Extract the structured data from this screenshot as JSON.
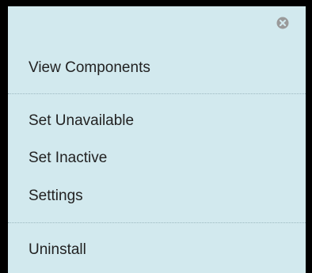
{
  "menu": {
    "close_icon": "close-circle-icon",
    "items": [
      {
        "label": "View Components"
      },
      {
        "label": "Set Unavailable"
      },
      {
        "label": "Set Inactive"
      },
      {
        "label": "Settings"
      },
      {
        "label": "Uninstall"
      }
    ]
  },
  "colors": {
    "background": "#d2e9ee",
    "text": "#222222",
    "divider": "#9cb8bf",
    "icon": "#9a9a9a",
    "frame": "#000000"
  }
}
